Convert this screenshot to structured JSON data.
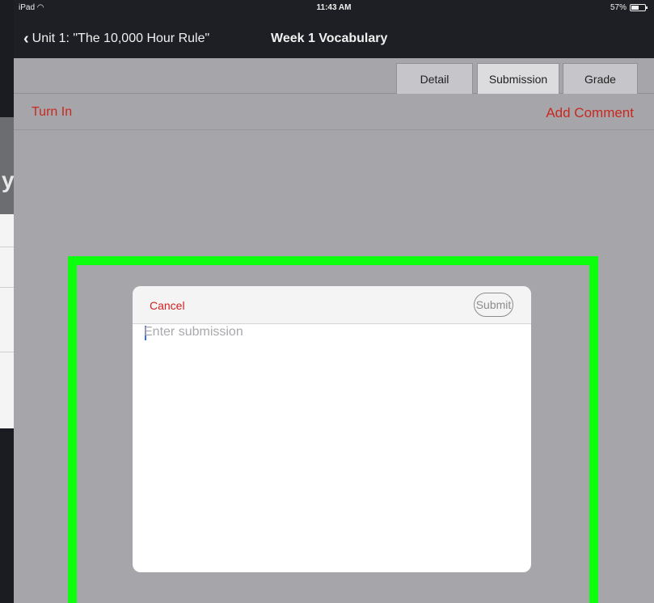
{
  "status_bar": {
    "device": "iPad",
    "time": "11:43 AM",
    "battery": "57%",
    "battery_level": 0.57
  },
  "nav": {
    "back_label": "Unit 1: \"The 10,000 Hour Rule\"",
    "title": "Week 1 Vocabulary"
  },
  "tabs": [
    {
      "label": "Detail",
      "active": false
    },
    {
      "label": "Submission",
      "active": true
    },
    {
      "label": "Grade",
      "active": false
    }
  ],
  "actions": {
    "turn_in": "Turn In",
    "add_comment": "Add Comment"
  },
  "modal": {
    "cancel_label": "Cancel",
    "submit_label": "Submit",
    "placeholder": "Enter submission",
    "value": ""
  },
  "background_page": {
    "glyph": "y"
  },
  "colors": {
    "accent_red": "#c8281e",
    "highlight_green": "#0cff0c",
    "nav_background": "#1d1f24"
  }
}
